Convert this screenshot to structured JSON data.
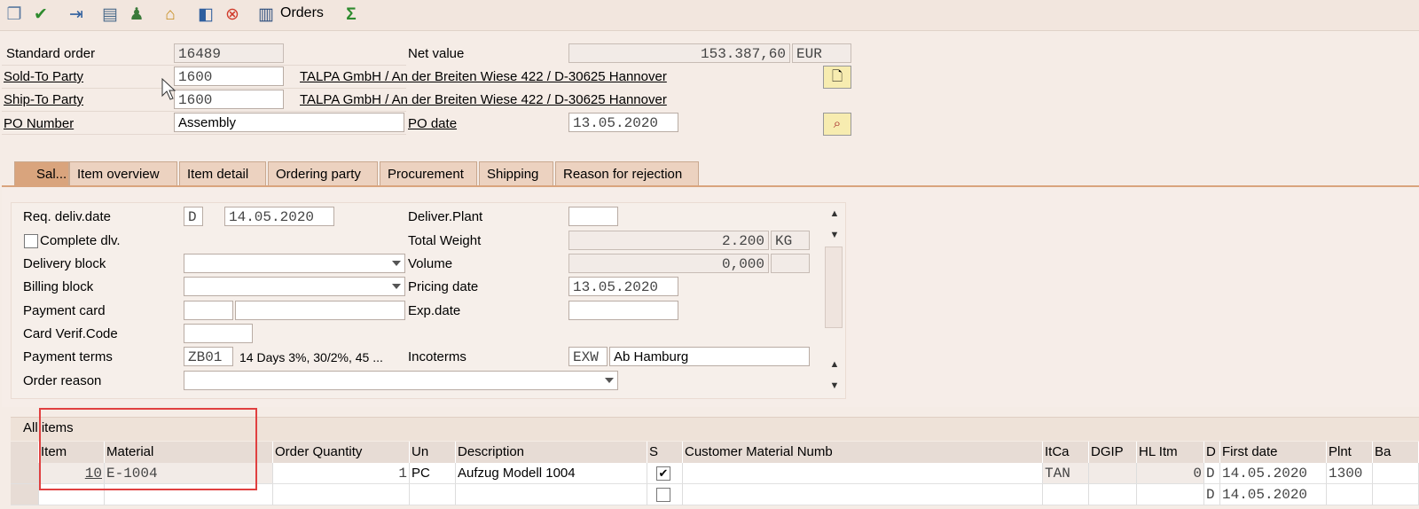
{
  "toolbar": {
    "icons": [
      "copy-document-icon",
      "check-cancel-icon",
      "import-icon",
      "clipboard-icon",
      "person-icon",
      "home-icon",
      "display-doc-icon",
      "delete-doc-icon",
      "columns-icon",
      "sum-icon"
    ],
    "orders_label": "Orders"
  },
  "header": {
    "standard_order_label": "Standard order",
    "standard_order_value": "16489",
    "net_value_label": "Net value",
    "net_value": "153.387,60",
    "currency": "EUR",
    "sold_to_label": "Sold-To Party",
    "sold_to_value": "1600",
    "sold_to_address": "TALPA GmbH / An der Breiten Wiese 422 / D-30625 Hannover",
    "ship_to_label": "Ship-To Party",
    "ship_to_value": "1600",
    "ship_to_address": "TALPA GmbH / An der Breiten Wiese 422 / D-30625 Hannover",
    "po_number_label": "PO Number",
    "po_number_value": "Assembly",
    "po_date_label": "PO date",
    "po_date_value": "13.05.2020"
  },
  "tabs": [
    "Sal...",
    "Item overview",
    "Item detail",
    "Ordering party",
    "Procurement",
    "Shipping",
    "Reason for rejection"
  ],
  "sales": {
    "req_deliv_label": "Req. deliv.date",
    "req_deliv_type": "D",
    "req_deliv_date": "14.05.2020",
    "deliver_plant_label": "Deliver.Plant",
    "complete_dlv_label": "Complete dlv.",
    "total_weight_label": "Total Weight",
    "total_weight_value": "2.200",
    "weight_unit": "KG",
    "delivery_block_label": "Delivery block",
    "volume_label": "Volume",
    "volume_value": "0,000",
    "billing_block_label": "Billing block",
    "pricing_date_label": "Pricing date",
    "pricing_date_value": "13.05.2020",
    "payment_card_label": "Payment card",
    "exp_date_label": "Exp.date",
    "card_verif_label": "Card Verif.Code",
    "payment_terms_label": "Payment terms",
    "payment_terms_code": "ZB01",
    "payment_terms_text": "14 Days 3%, 30/2%, 45 ...",
    "incoterms_label": "Incoterms",
    "incoterms_code": "EXW",
    "incoterms_place": "Ab Hamburg",
    "order_reason_label": "Order reason"
  },
  "items": {
    "title": "All items",
    "columns": [
      "Item",
      "Material",
      "Order Quantity",
      "Un",
      "Description",
      "S",
      "Customer Material Numb",
      "ItCa",
      "DGIP",
      "HL Itm",
      "D",
      "First date",
      "Plnt",
      "Ba"
    ],
    "row1": {
      "item": "10",
      "material": "E-1004",
      "qty": "1",
      "unit": "PC",
      "description": "Aufzug Modell 1004",
      "itca": "TAN",
      "hl_itm": "0",
      "d": "D",
      "first_date": "14.05.2020",
      "plnt": "1300"
    },
    "row2": {
      "d": "D",
      "first_date": "14.05.2020"
    }
  }
}
